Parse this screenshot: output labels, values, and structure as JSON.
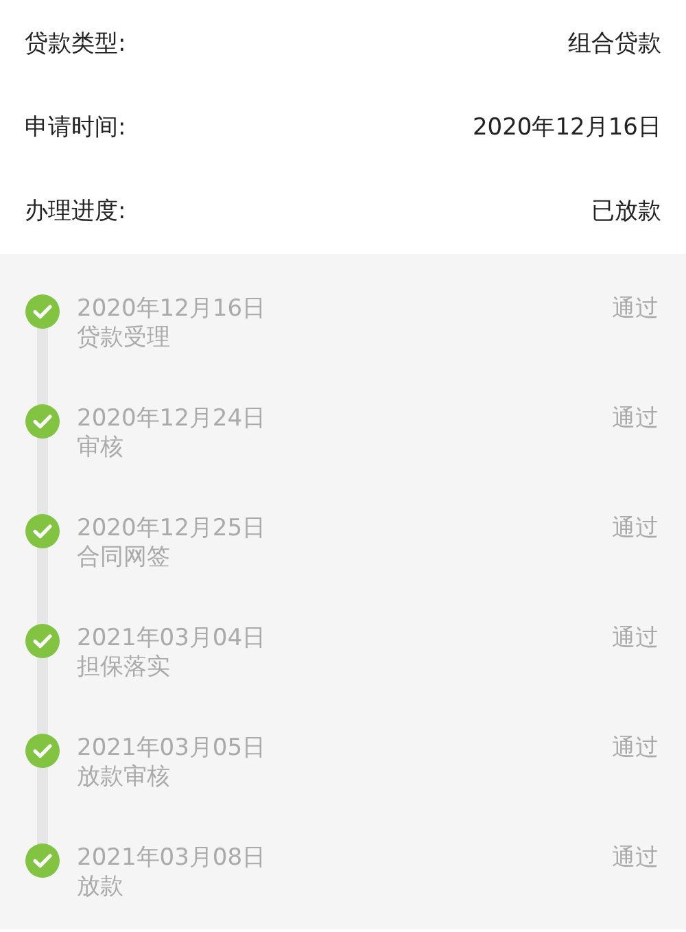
{
  "details": [
    {
      "label": "贷款类型:",
      "value": "组合贷款"
    },
    {
      "label": "申请时间:",
      "value": "2020年12月16日"
    },
    {
      "label": "办理进度:",
      "value": "已放款"
    }
  ],
  "timeline": [
    {
      "date": "2020年12月16日",
      "step": "贷款受理",
      "result": "通过",
      "done": true
    },
    {
      "date": "2020年12月24日",
      "step": "审核",
      "result": "通过",
      "done": true
    },
    {
      "date": "2020年12月25日",
      "step": "合同网签",
      "result": "通过",
      "done": true
    },
    {
      "date": "2021年03月04日",
      "step": "担保落实",
      "result": "通过",
      "done": true
    },
    {
      "date": "2021年03月05日",
      "step": "放款审核",
      "result": "通过",
      "done": true
    },
    {
      "date": "2021年03月08日",
      "step": "放款",
      "result": "通过",
      "done": true
    }
  ]
}
